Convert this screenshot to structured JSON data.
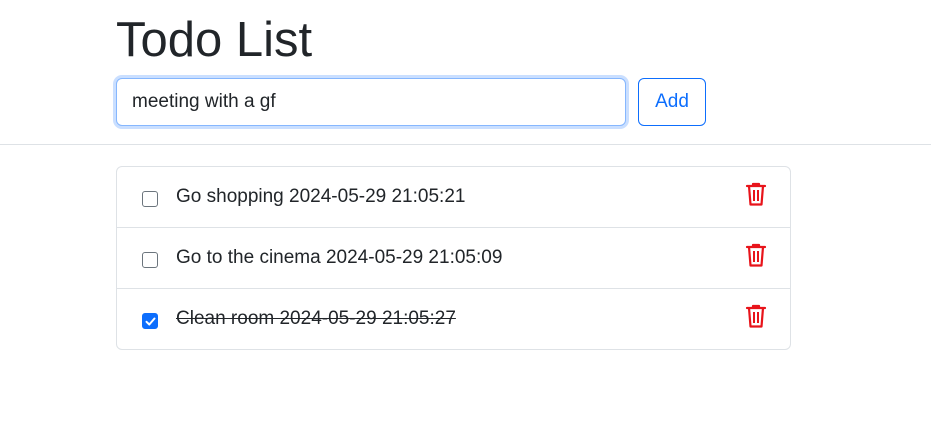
{
  "header": {
    "title": "Todo List",
    "input_value": "meeting with a gf",
    "add_label": "Add"
  },
  "todos": [
    {
      "text": "Go shopping 2024-05-29 21:05:21",
      "done": false
    },
    {
      "text": "Go to the cinema 2024-05-29 21:05:09",
      "done": false
    },
    {
      "text": "Clean room 2024-05-29 21:05:27",
      "done": true
    }
  ],
  "icons": {
    "delete": "trash-icon",
    "check": "checkmark-icon"
  },
  "colors": {
    "primary": "#0d6efd",
    "danger": "#e8141b",
    "text": "#212529",
    "border": "#dee2e6"
  }
}
